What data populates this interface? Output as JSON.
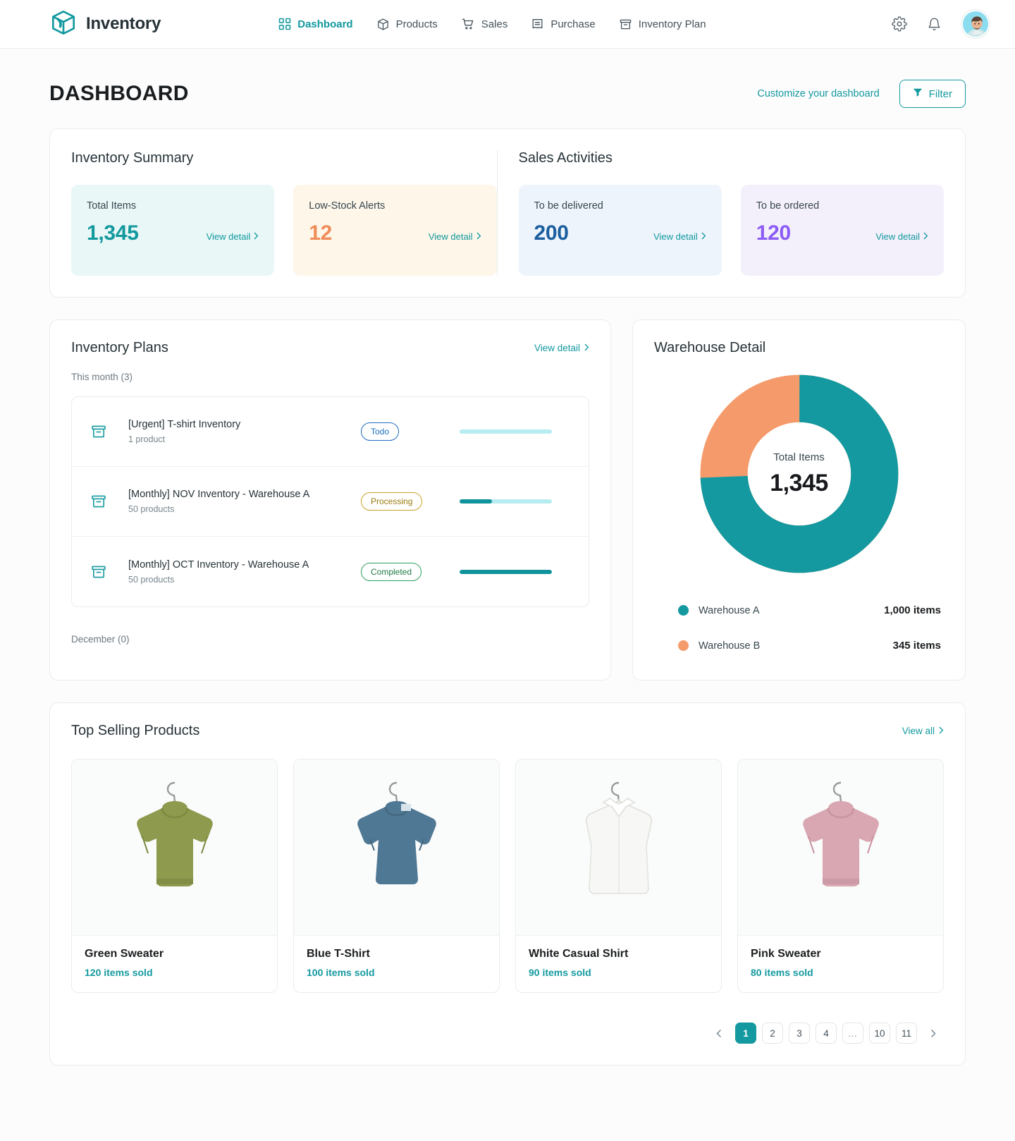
{
  "brand": {
    "name": "Inventory",
    "logo_icon": "box-cube-icon",
    "color": "#13999f"
  },
  "nav": {
    "items": [
      {
        "label": "Dashboard",
        "icon": "grid-dashboard-icon",
        "active": true
      },
      {
        "label": "Products",
        "icon": "box-package-icon",
        "active": false
      },
      {
        "label": "Sales",
        "icon": "shopping-cart-icon",
        "active": false
      },
      {
        "label": "Purchase",
        "icon": "receipt-icon",
        "active": false
      },
      {
        "label": "Inventory Plan",
        "icon": "archive-box-icon",
        "active": false
      }
    ],
    "settings_icon": "gear-icon",
    "notifications_icon": "bell-icon",
    "avatar_icon": "user-avatar"
  },
  "header": {
    "title": "DASHBOARD",
    "customize_label": "Customize your dashboard",
    "filter_label": "Filter",
    "filter_icon": "funnel-icon"
  },
  "inventory_summary": {
    "title": "Inventory Summary",
    "cards": [
      {
        "label": "Total Items",
        "value": "1,345",
        "link": "View detail",
        "theme": "cy"
      },
      {
        "label": "Low-Stock Alerts",
        "value": "12",
        "link": "View detail",
        "theme": "am"
      }
    ]
  },
  "sales_activities": {
    "title": "Sales Activities",
    "cards": [
      {
        "label": "To be delivered",
        "value": "200",
        "link": "View detail",
        "theme": "bl"
      },
      {
        "label": "To be ordered",
        "value": "120",
        "link": "View detail",
        "theme": "pu"
      }
    ]
  },
  "inventory_plans": {
    "title": "Inventory Plans",
    "view_detail": "View detail",
    "this_month": "This month (3)",
    "december": "December (0)",
    "rows": [
      {
        "name": "[Urgent] T-shirt Inventory",
        "sub": "1 product",
        "status": "Todo",
        "status_class": "todo",
        "progress": 0
      },
      {
        "name": "[Monthly] NOV Inventory - Warehouse A",
        "sub": "50 products",
        "status": "Processing",
        "status_class": "processing",
        "progress": 35
      },
      {
        "name": "[Monthly] OCT Inventory - Warehouse A",
        "sub": "50 products",
        "status": "Completed",
        "status_class": "completed",
        "progress": 100
      }
    ]
  },
  "warehouse_detail": {
    "title": "Warehouse Detail",
    "center_label": "Total Items",
    "center_value": "1,345",
    "legend": [
      {
        "name": "Warehouse A",
        "value": "1,000 items",
        "color": "#13999f"
      },
      {
        "name": "Warehouse B",
        "value": "345 items",
        "color": "#f59a6a"
      }
    ]
  },
  "chart_data": {
    "type": "pie",
    "title": "Warehouse Detail",
    "labels": [
      "Warehouse A",
      "Warehouse B"
    ],
    "values": [
      1000,
      345
    ],
    "colors": [
      "#13999f",
      "#f59a6a"
    ],
    "total": 1345,
    "center_label": "Total Items",
    "center_value": "1,345",
    "legend_position": "bottom",
    "donut": true,
    "inner_radius_ratio": 0.62
  },
  "top_selling": {
    "title": "Top Selling Products",
    "view_all": "View all",
    "products": [
      {
        "name": "Green Sweater",
        "sold": "120 items sold",
        "swatch": "#8e9a4e"
      },
      {
        "name": "Blue T-Shirt",
        "sold": "100 items sold",
        "swatch": "#4f7894"
      },
      {
        "name": "White Casual Shirt",
        "sold": "90 items sold",
        "swatch": "#f2f2f0"
      },
      {
        "name": "Pink Sweater",
        "sold": "80 items sold",
        "swatch": "#d8a7b2"
      }
    ],
    "pagination": {
      "prev_icon": "chevron-left-icon",
      "next_icon": "chevron-right-icon",
      "pages": [
        "1",
        "2",
        "3",
        "4",
        "…",
        "10",
        "11"
      ],
      "active": "1"
    }
  }
}
